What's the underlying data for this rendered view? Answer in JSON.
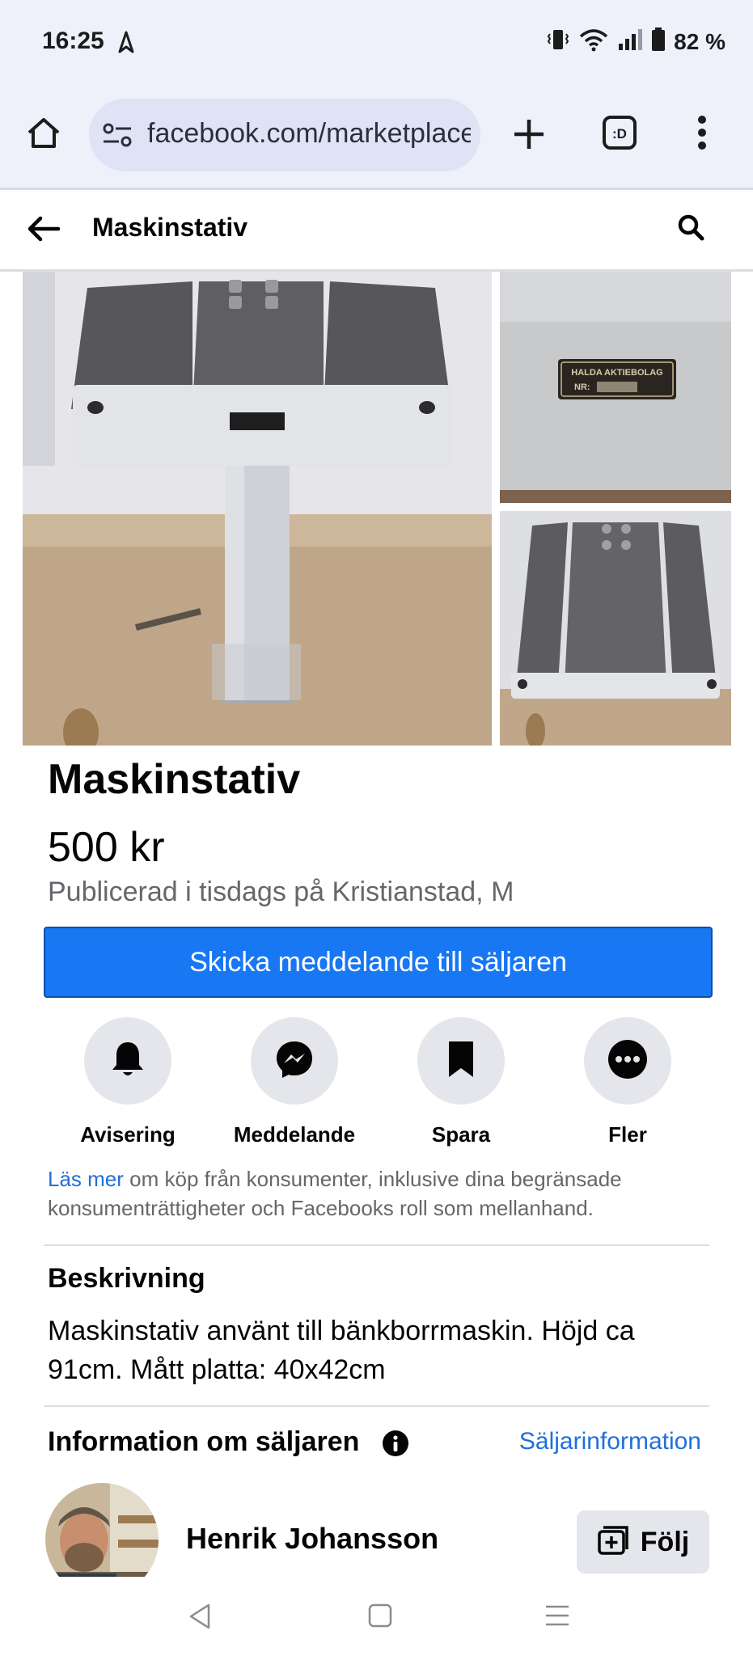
{
  "status_bar": {
    "time": "16:25",
    "battery": "82 %",
    "icons": [
      "navigation-arrow-icon",
      "vibrate-icon",
      "wifi-icon",
      "signal-icon",
      "battery-icon"
    ]
  },
  "browser": {
    "url": "facebook.com/marketplace",
    "icons": [
      "home-icon",
      "site-settings-icon",
      "new-tab-icon",
      "tab-switcher-icon",
      "more-menu-icon"
    ]
  },
  "app_bar": {
    "title": "Maskinstativ",
    "icons": [
      "back-arrow-icon",
      "search-icon"
    ]
  },
  "gallery": {
    "images": [
      "machine-stand-photo",
      "nameplate-closeup-photo",
      "table-top-photo"
    ],
    "nameplate_text": [
      "HALDA AKTIEBOLAG",
      "NR:"
    ]
  },
  "listing": {
    "title": "Maskinstativ",
    "price": "500 kr",
    "meta": "Publicerad i tisdags på Kristianstad, M",
    "primary_button": "Skicka meddelande till säljaren"
  },
  "actions": [
    {
      "label": "Avisering",
      "icon": "bell-icon"
    },
    {
      "label": "Meddelande",
      "icon": "messenger-icon"
    },
    {
      "label": "Spara",
      "icon": "bookmark-icon"
    },
    {
      "label": "Fler",
      "icon": "more-icon"
    }
  ],
  "consumer_note": {
    "link": "Läs mer",
    "text": " om köp från konsumenter, inklusive dina begränsade konsumenträttigheter och Facebooks roll som mellanhand."
  },
  "description": {
    "heading": "Beskrivning",
    "text": "Maskinstativ använt till bänkborrmaskin. Höjd ca 91cm. Mått platta: 40x42cm"
  },
  "seller": {
    "heading": "Information om säljaren",
    "info_link": "Säljarinformation",
    "name": "Henrik Johansson",
    "follow_label": "Följ"
  },
  "colors": {
    "accent": "#1877f2",
    "link": "#216fdb",
    "muted_text": "#65676b",
    "chip_bg": "#e4e6eb",
    "browser_bg": "#eef0fa"
  }
}
